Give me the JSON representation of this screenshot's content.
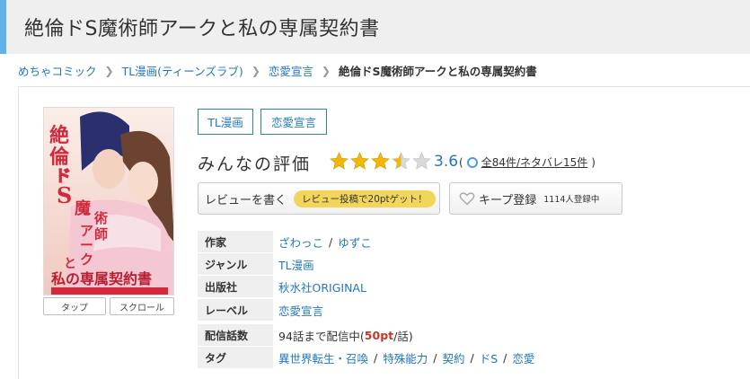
{
  "page_title": "絶倫ドS魔術師アークと私の専属契約書",
  "breadcrumb": {
    "items": [
      "めちゃコミック",
      "TL漫画(ティーンズラブ)",
      "恋愛宣言"
    ],
    "current": "絶倫ドS魔術師アークと私の専属契約書"
  },
  "cover": {
    "title_lines": [
      "絶倫ドS",
      "魔術師",
      "アーク",
      "と",
      "私の専属契約書"
    ],
    "buttons": [
      "タップ",
      "スクロール"
    ]
  },
  "genre_tags": [
    "TL漫画",
    "恋愛宣言"
  ],
  "rating": {
    "label": "みんなの評価",
    "stars": 3.6,
    "value": "3.6",
    "count_all": "全84件",
    "count_spoiler": "/ネタバレ15件",
    "paren_open": "(",
    "paren_close": ")"
  },
  "review_button": {
    "label": "レビューを書く",
    "promo": "レビュー投稿で20ptゲット！"
  },
  "keep_button": {
    "label": "キープ登録",
    "count": "1114人登録中"
  },
  "info": {
    "author": {
      "label": "作家",
      "values": [
        "ざわっこ",
        "ゆずこ"
      ]
    },
    "genre": {
      "label": "ジャンル",
      "value": "TL漫画"
    },
    "publisher": {
      "label": "出版社",
      "value": "秋水社ORIGINAL"
    },
    "label": {
      "label": "レーベル",
      "value": "恋愛宣言"
    },
    "episodes": {
      "label": "配信話数",
      "prefix": "94話まで配信中(",
      "price": "50pt",
      "suffix": "/話)"
    },
    "tags": {
      "label": "タグ",
      "values": [
        "異世界転生・召喚",
        "特殊能力",
        "契約",
        "ドS",
        "恋愛"
      ]
    }
  },
  "colors": {
    "accent": "#5fb3e6",
    "link": "#2277bb",
    "star": "#f2b705",
    "promo": "#f2d65a",
    "price": "#c0392b"
  }
}
